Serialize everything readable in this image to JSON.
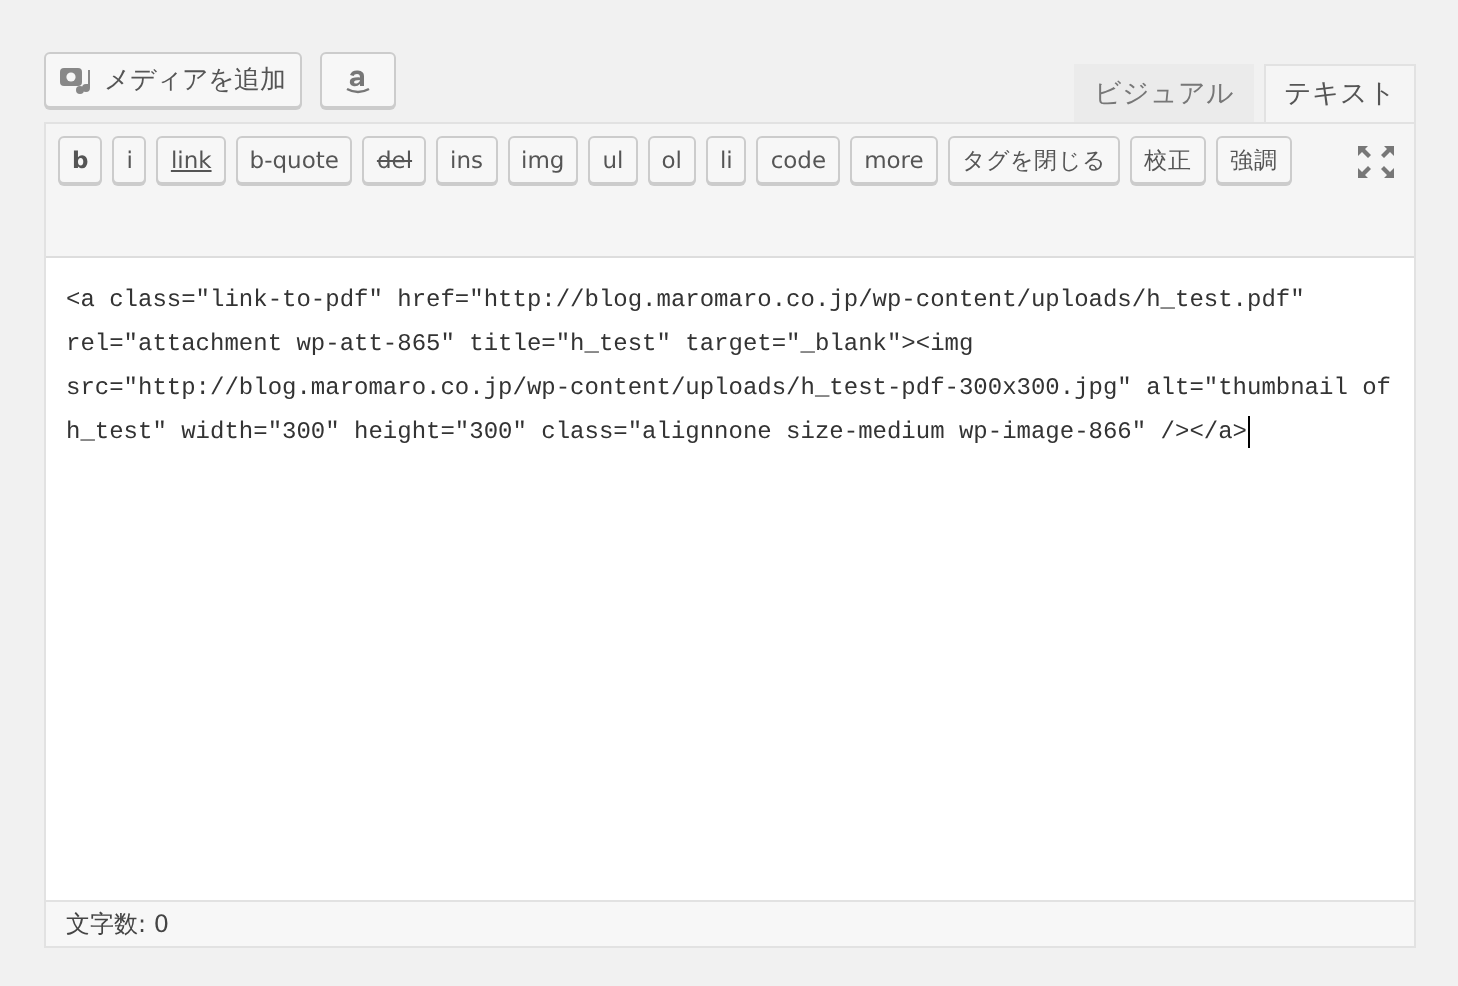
{
  "toolbar_top": {
    "add_media": "メディアを追加"
  },
  "tabs": [
    {
      "label": "ビジュアル",
      "selected": false
    },
    {
      "label": "テキスト",
      "selected": true
    }
  ],
  "quicktags": [
    {
      "label": "b",
      "kind": "bold"
    },
    {
      "label": "i",
      "kind": "plain"
    },
    {
      "label": "link",
      "kind": "link"
    },
    {
      "label": "b-quote",
      "kind": "plain"
    },
    {
      "label": "del",
      "kind": "del"
    },
    {
      "label": "ins",
      "kind": "plain"
    },
    {
      "label": "img",
      "kind": "plain"
    },
    {
      "label": "ul",
      "kind": "plain"
    },
    {
      "label": "ol",
      "kind": "plain"
    },
    {
      "label": "li",
      "kind": "plain"
    },
    {
      "label": "code",
      "kind": "plain"
    },
    {
      "label": "more",
      "kind": "plain"
    },
    {
      "label": "タグを閉じる",
      "kind": "plain"
    },
    {
      "label": "校正",
      "kind": "plain"
    },
    {
      "label": "強調",
      "kind": "plain"
    }
  ],
  "editor": {
    "lines": [
      "<a class=\"link-to-pdf\" href=\"http://blog.maromaro.co.jp/wp-content/uploads/h_test.pdf\"",
      "rel=\"attachment wp-att-865\" title=\"h_test\" target=\"_blank\"><img",
      "src=\"http://blog.maromaro.co.jp/wp-content/uploads/h_test-pdf-300x300.jpg\" alt=\"thumbnail of",
      "h_test\" width=\"300\" height=\"300\" class=\"alignnone size-medium wp-image-866\" /></a>"
    ]
  },
  "status_bar": {
    "word_count": "文字数: 0"
  }
}
